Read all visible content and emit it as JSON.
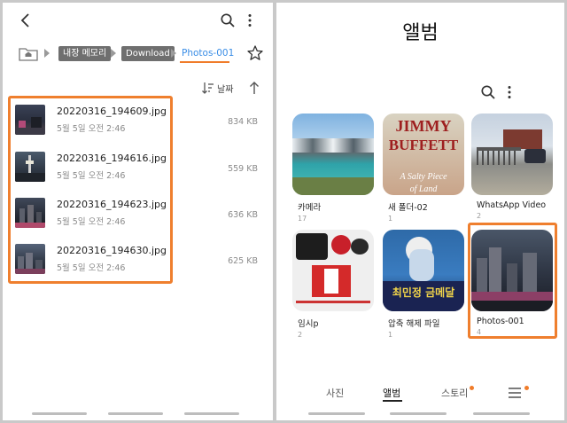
{
  "colors": {
    "accent": "#f07c2a",
    "link": "#3b8ee6",
    "chip": "#6f6f6f"
  },
  "left": {
    "breadcrumb": [
      "내장 메모리",
      "Download",
      "Photos-001"
    ],
    "sort_label": "날짜",
    "files": [
      {
        "name": "20220316_194609.jpg",
        "date": "5월 5일 오전 2:46",
        "size": "834 KB"
      },
      {
        "name": "20220316_194616.jpg",
        "date": "5월 5일 오전 2:46",
        "size": "559 KB"
      },
      {
        "name": "20220316_194623.jpg",
        "date": "5월 5일 오전 2:46",
        "size": "636 KB"
      },
      {
        "name": "20220316_194630.jpg",
        "date": "5월 5일 오전 2:46",
        "size": "625 KB"
      }
    ]
  },
  "right": {
    "title": "앨범",
    "albums": [
      {
        "name": "카메라",
        "count": "17"
      },
      {
        "name": "새 폴더-02",
        "count": "1",
        "cover_text": [
          "JIMMY",
          "BUFFETT",
          "A Salty Piece",
          "of Land"
        ]
      },
      {
        "name": "WhatsApp Video",
        "count": "2"
      },
      {
        "name": "임시p",
        "count": "2"
      },
      {
        "name": "압축 해제 파일",
        "count": "1",
        "cover_text": [
          "최민정 금메달"
        ]
      },
      {
        "name": "Photos-001",
        "count": "4"
      }
    ],
    "tabs": [
      "사진",
      "앨범",
      "스토리"
    ]
  }
}
